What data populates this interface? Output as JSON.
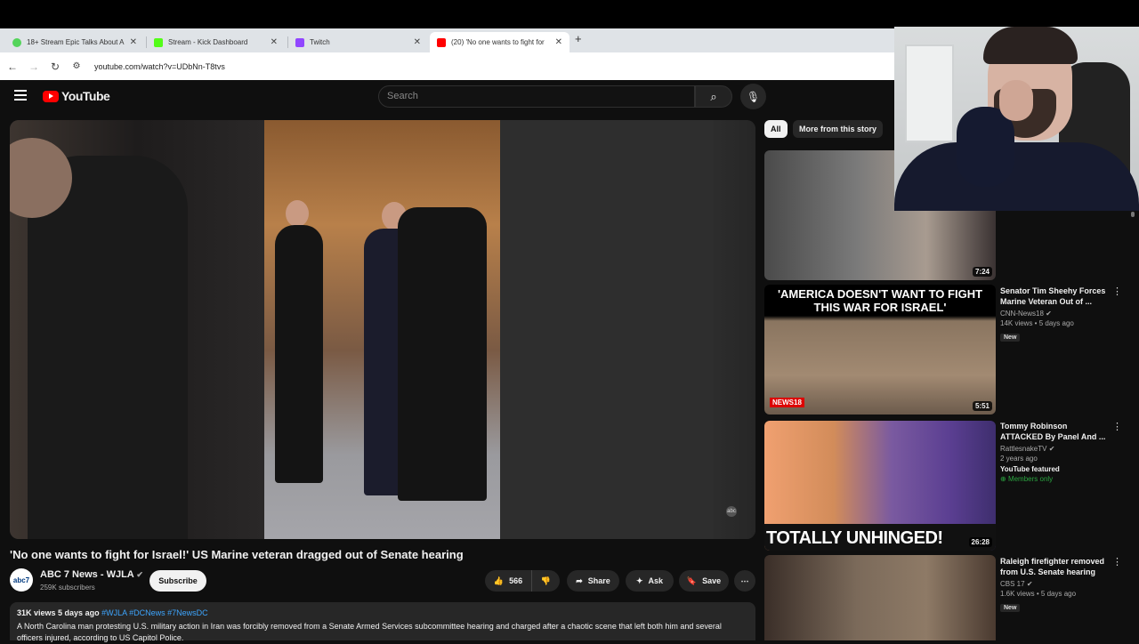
{
  "browser": {
    "tabs": [
      {
        "title": "18+ Stream Epic Talks About A",
        "color": "#53d45a"
      },
      {
        "title": "Stream - Kick Dashboard",
        "color": "#53fc18"
      },
      {
        "title": "Twitch",
        "color": "#9146ff"
      },
      {
        "title": "(20) 'No one wants to fight for",
        "color": "#ff0000"
      }
    ],
    "url": "youtube.com/watch?v=UDbNn-T8tvs"
  },
  "youtube": {
    "logo": "YouTube",
    "search_placeholder": "Search",
    "video_title": "'No one wants to fight for Israel!' US Marine veteran dragged out of Senate hearing",
    "channel": {
      "name": "ABC 7 News - WJLA",
      "subscribers": "259K subscribers",
      "avatar_text": "abc7"
    },
    "subscribe_label": "Subscribe",
    "actions": {
      "likes": "566",
      "share": "Share",
      "ask": "Ask",
      "save": "Save"
    },
    "description": {
      "views": "31K views",
      "date": "5 days ago",
      "tags": "#WJLA #DCNews #7NewsDC",
      "text": "A North Carolina man protesting U.S. military action in Iran was forcibly removed from a Senate Armed Services subcommittee hearing and charged after a chaotic scene that left both him and several officers injured, according to US Capitol Police."
    },
    "chips": [
      "All",
      "More from this story"
    ],
    "related": [
      {
        "title": "",
        "channel": "",
        "meta": "",
        "duration": "7:24",
        "badge": "",
        "thumb_text": ""
      },
      {
        "title": "Senator Tim Sheehy Forces Marine Veteran Out of ...",
        "channel": "CNN-News18",
        "meta": "14K views • 5 days ago",
        "duration": "5:51",
        "badge": "New",
        "thumb_text": "'AMERICA DOESN'T WANT TO FIGHT THIS WAR FOR ISRAEL'",
        "logo_text": "NEWS18"
      },
      {
        "title": "Tommy Robinson ATTACKED By Panel And ...",
        "channel": "RattlesnakeTV",
        "meta": "2 years ago",
        "duration": "26:28",
        "badge": "YouTube featured",
        "members": "Members only",
        "thumb_text": "TOTALLY UNHINGED!"
      },
      {
        "title": "Raleigh firefighter removed from U.S. Senate hearing",
        "channel": "CBS 17",
        "meta": "1.6K views • 5 days ago",
        "duration": "",
        "badge": "New",
        "thumb_text": ""
      }
    ]
  },
  "icons": {
    "verified": "check-circle",
    "like": "thumbs-up",
    "dislike": "thumbs-down",
    "share": "share-arrow",
    "ask": "sparkle",
    "save": "bookmark",
    "more": "three-dots"
  }
}
